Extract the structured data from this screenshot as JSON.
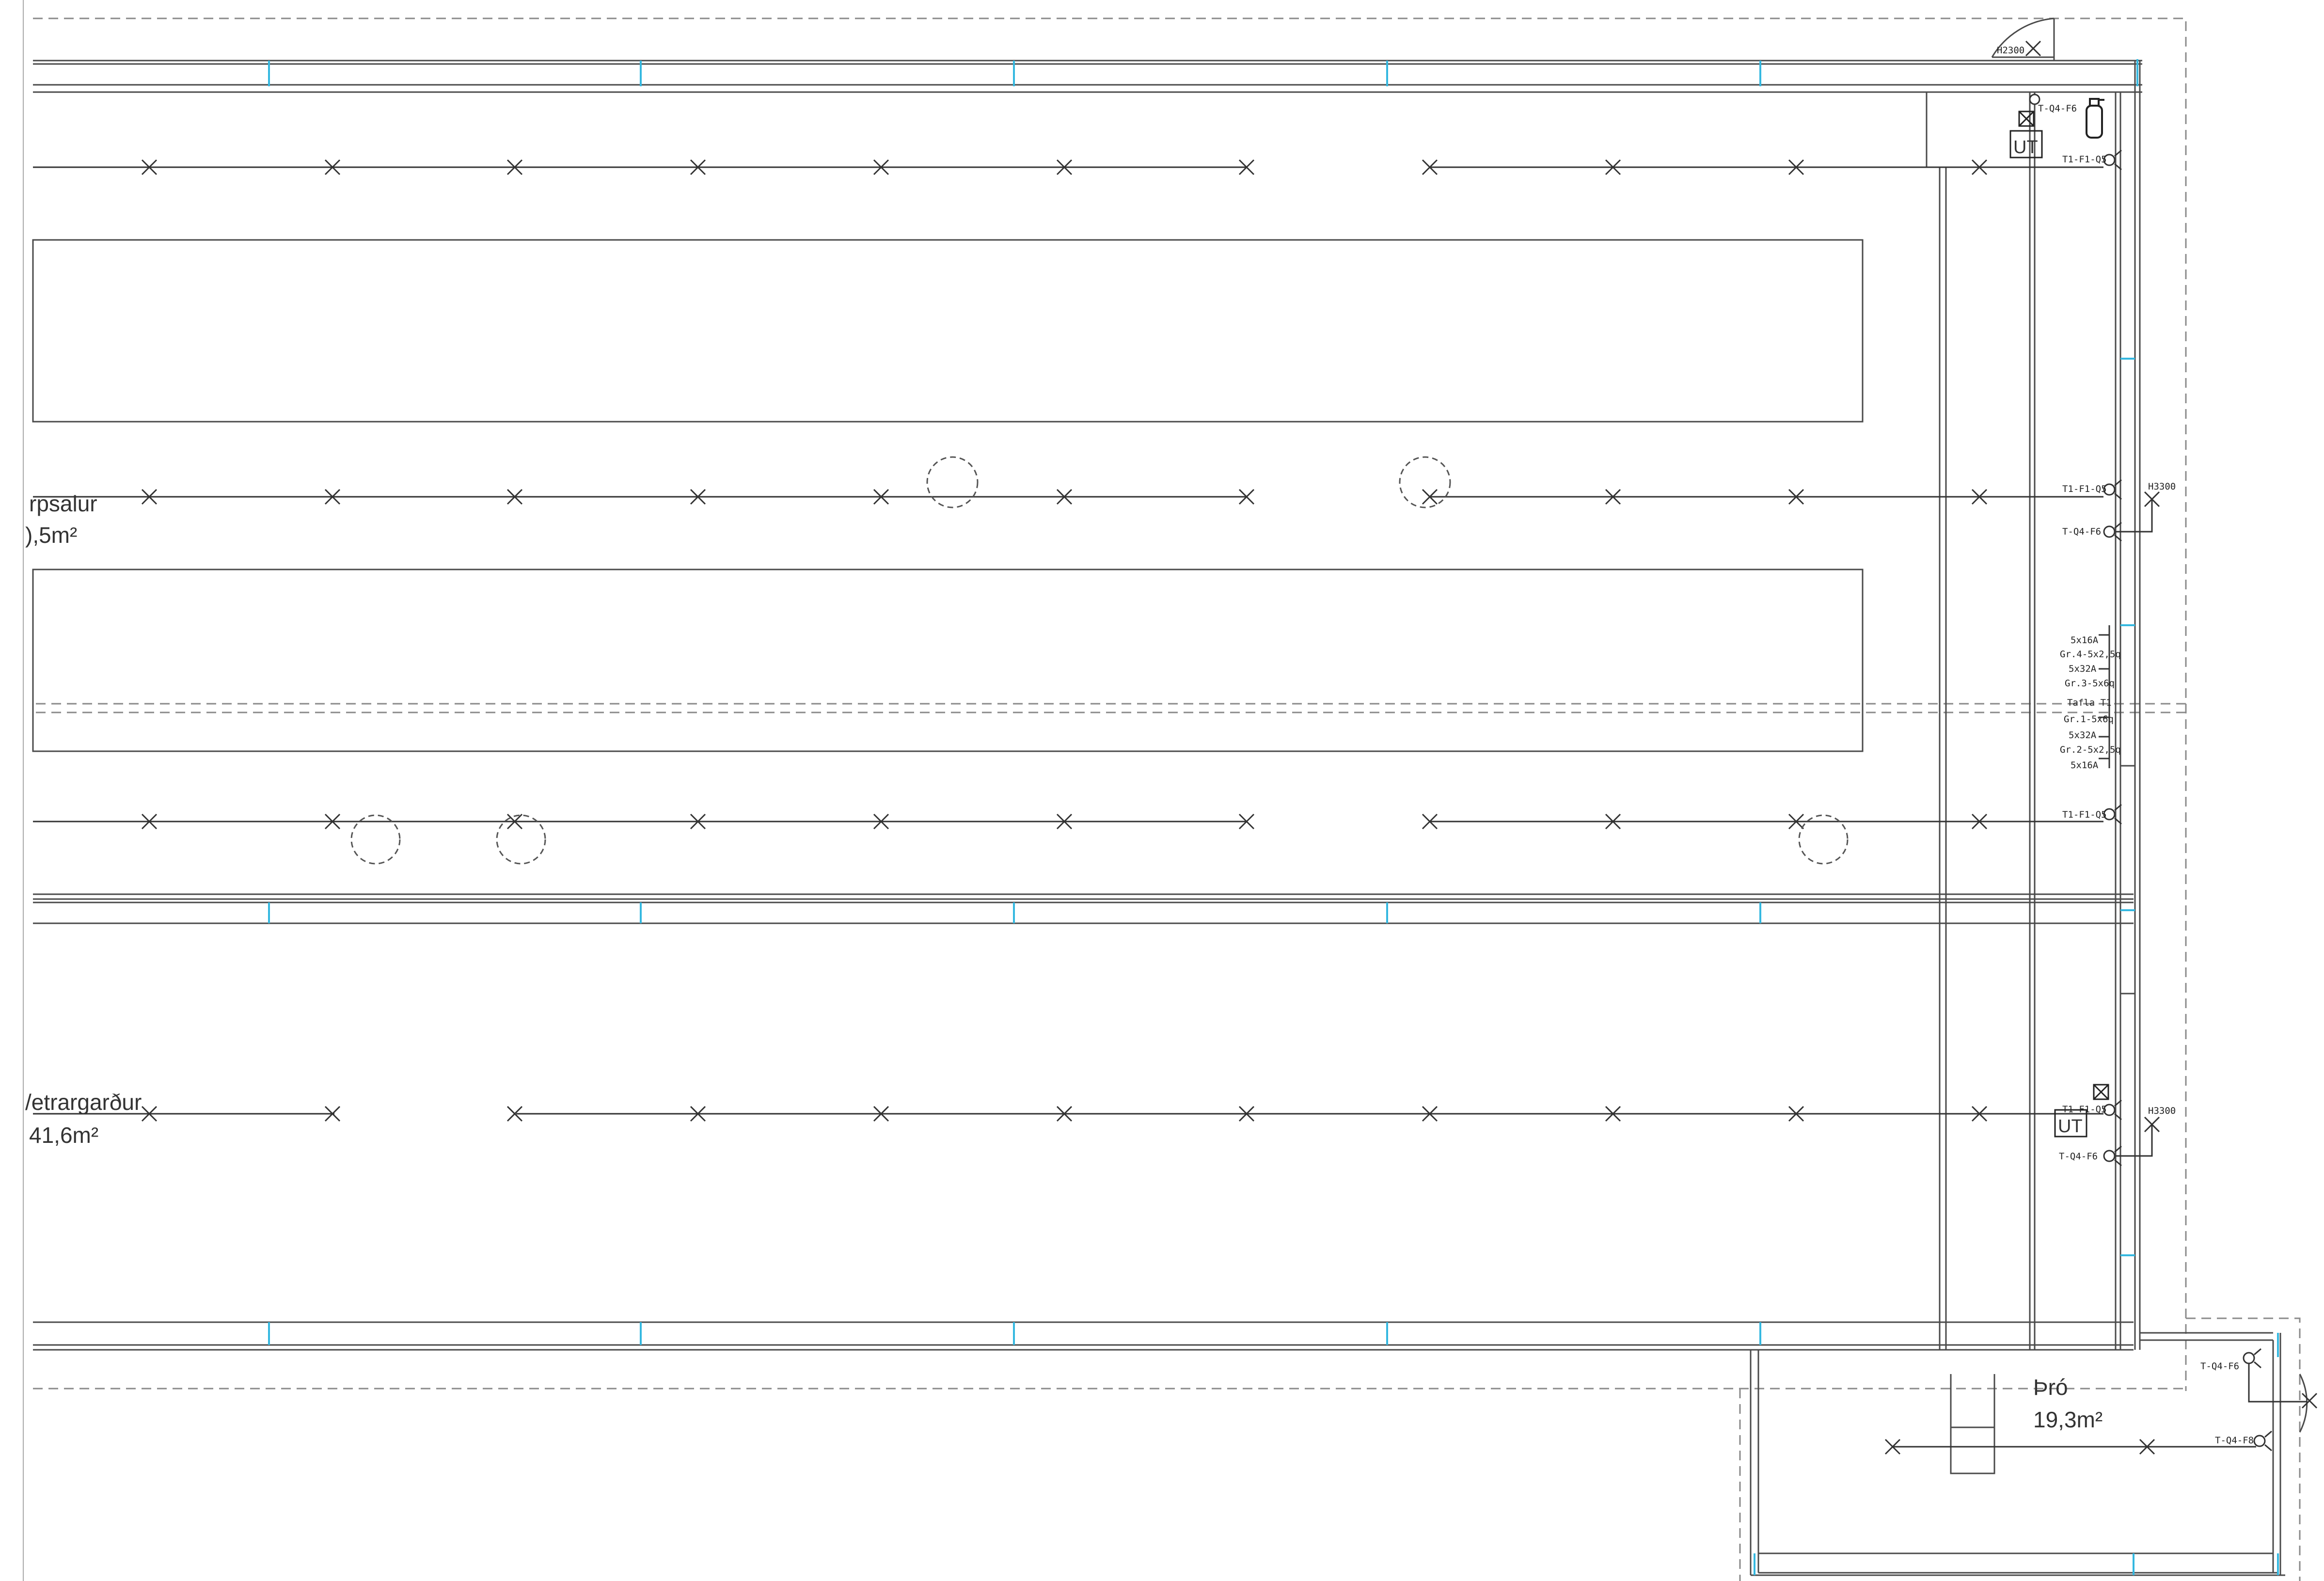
{
  "rooms": {
    "salur": {
      "name": "rpsalur",
      "area": "),5m²"
    },
    "vetrargardur": {
      "name": "/etrargarður",
      "area": "41,6m²"
    },
    "tro": {
      "name": "Þró",
      "area": "19,3m²"
    }
  },
  "labels": {
    "ut_1": "UT",
    "ut_2": "UT",
    "h_top": "H2300",
    "h_mid": "H3300",
    "h_low": "H3300",
    "top_q4": "T-Q4-F6",
    "top_f1": "T1-F1-Q5",
    "mid_f1": "T1-F1-Q5",
    "mid_q4": "T-Q4-F6",
    "p1": "5x16A",
    "p2": "Gr.4-5x2,5q",
    "p3": "5x32A",
    "p4": "Gr.3-5x6q",
    "p5": "Tafla T1",
    "p6": "Gr.1-5x6q",
    "p7": "5x32A",
    "p8": "Gr.2-5x2,5q",
    "p9": "5x16A",
    "low_f1": "T1-F1-Q5",
    "bot_f1": "T1-F1-Q5",
    "bot_q4": "T-Q4-F6",
    "tro_q4": "T-Q4-F6",
    "tro_f8": "T-Q4-F8"
  },
  "colors": {
    "line": "#4a4a4a",
    "window_accent": "#35b8e0",
    "dashed": "#8a8a8a"
  },
  "icons": [
    "light-fixture-cross-icon",
    "socket-icon",
    "fire-extinguisher-icon",
    "door-swing-icon"
  ]
}
